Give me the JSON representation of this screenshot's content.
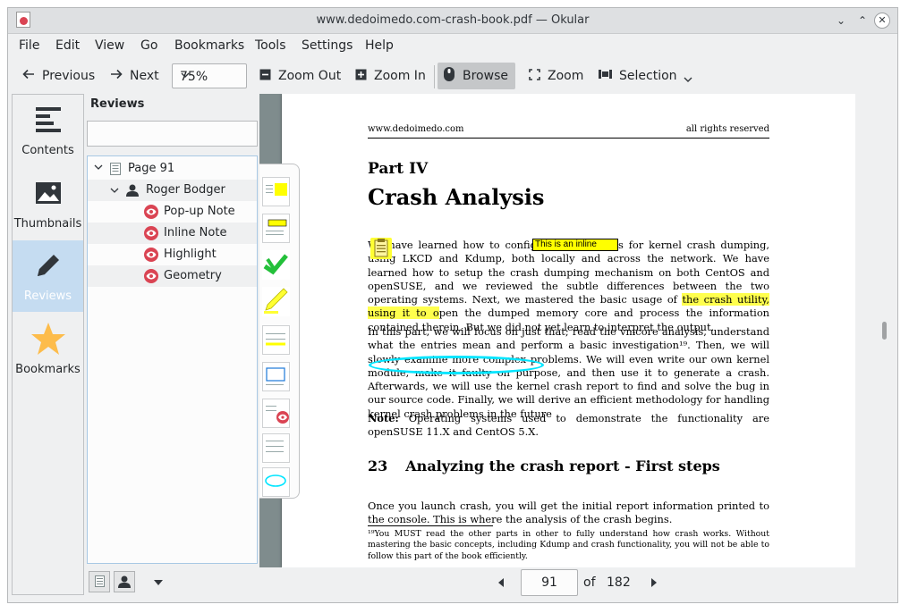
{
  "window": {
    "title": "www.dedoimedo.com-crash-book.pdf — Okular"
  },
  "menu": [
    "File",
    "Edit",
    "View",
    "Go",
    "Bookmarks",
    "Tools",
    "Settings",
    "Help"
  ],
  "toolbar": {
    "previous": "Previous",
    "next": "Next",
    "zoom_value": "75%",
    "zoom_out": "Zoom Out",
    "zoom_in": "Zoom In",
    "browse": "Browse",
    "zoom": "Zoom",
    "selection": "Selection"
  },
  "sidebar": {
    "items": [
      {
        "label": "Contents",
        "icon": "contents-icon"
      },
      {
        "label": "Thumbnails",
        "icon": "image-icon"
      },
      {
        "label": "Reviews",
        "icon": "pencil-icon",
        "active": true
      },
      {
        "label": "Bookmarks",
        "icon": "star-icon"
      }
    ]
  },
  "reviews": {
    "title": "Reviews",
    "filter_placeholder": "",
    "tree": {
      "page": "Page 91",
      "author": "Roger Bodger",
      "annotations": [
        "Pop-up Note",
        "Inline Note",
        "Highlight",
        "Geometry"
      ]
    }
  },
  "document": {
    "header_left": "www.dedoimedo.com",
    "header_right": "all rights reserved",
    "part": "Part IV",
    "chapter": "Crash Analysis",
    "p1_a": "We have learned how to configure our systems for kernel crash dumping, using LKCD and Kdump, both locally and across the network. We have learned how to setup the crash dumping mechanism on both CentOS and openSUSE, and we reviewed the subtle differences between the two operating systems. Next, we mastered the basic usage of ",
    "p1_hl": "the crash utility, using it to o",
    "p1_b": "pen the dumped memory core and process the information contained therein. But we did not yet learn to interpret the output.",
    "p2": "In this part, we will focus on just that; read the vmcore analysis, understand what the entries mean and perform a basic investigation¹⁹. Then, we will slowly examine more complex problems. We will even write our own kernel module, make it faulty on purpose, and then use it to generate a crash. Afterwards, we will use the kernel crash report to find and solve the bug in our source code. Finally, we will derive an efficient methodology for handling kernel crash problems in the future",
    "note_label": "Note:",
    "note_text": " Operating systems used to demonstrate the functionality are openSUSE 11.X and CentOS 5.X.",
    "section_num": "23",
    "section_title": "Analyzing the crash report - First steps",
    "p3": "Once you launch crash, you will get the initial report information printed to the console. This is where the analysis of the crash begins.",
    "footnote": "¹⁹You MUST read the other parts in other to fully understand how crash works. Without mastering the basic concepts, including Kdump and crash functionality, you will not be able to follow this part of the book efficiently.",
    "inline_note": "This is an inline"
  },
  "nav": {
    "page": "91",
    "of": "of",
    "total": "182"
  },
  "colors": {
    "accent": "#3daee9",
    "highlight": "#ffff4d",
    "geometry": "#00e5ff",
    "annotation_icon": "#da4453"
  }
}
